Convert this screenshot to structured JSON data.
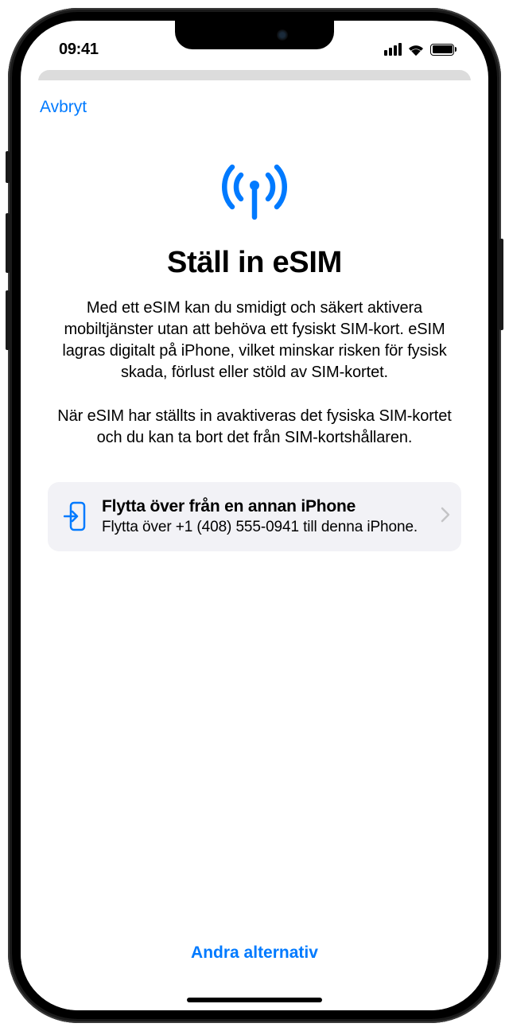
{
  "status": {
    "time": "09:41"
  },
  "sheet": {
    "cancel": "Avbryt"
  },
  "page": {
    "title": "Ställ in eSIM",
    "description1": "Med ett eSIM kan du smidigt och säkert aktivera mobiltjänster utan att behöva ett fysiskt SIM-kort. eSIM lagras digitalt på iPhone, vilket minskar risken för fysisk skada, förlust eller stöld av SIM-kortet.",
    "description2": "När eSIM har ställts in avaktiveras det fysiska SIM-kortet och du kan ta bort det från SIM-kortshållaren."
  },
  "option": {
    "title": "Flytta över från en annan iPhone",
    "subtitle": "Flytta över +1 (408) 555-0941 till denna iPhone."
  },
  "footer": {
    "other": "Andra alternativ"
  }
}
